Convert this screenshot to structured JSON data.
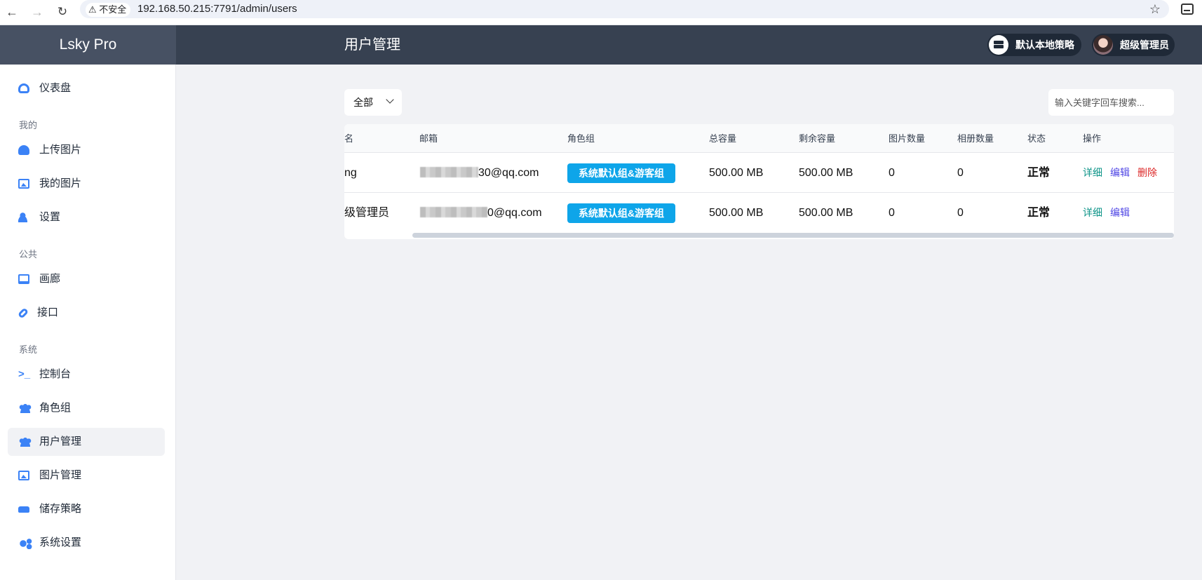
{
  "browser": {
    "security_label": "不安全",
    "url": "192.168.50.215:7791/admin/users"
  },
  "app": {
    "brand": "Lsky Pro",
    "page_title": "用户管理"
  },
  "header": {
    "strategy_label": "默认本地策略",
    "user_label": "超级管理员"
  },
  "sidebar": {
    "items": {
      "dashboard": "仪表盘",
      "section_mine": "我的",
      "upload": "上传图片",
      "my_images": "我的图片",
      "settings": "设置",
      "section_public": "公共",
      "gallery": "画廊",
      "api": "接口",
      "section_system": "系统",
      "console": "控制台",
      "groups": "角色组",
      "users": "用户管理",
      "images": "图片管理",
      "strategies": "储存策略",
      "system_settings": "系统设置"
    },
    "active": "users"
  },
  "filter": {
    "selected": "全部",
    "search_placeholder": "输入关键字回车搜索..."
  },
  "table": {
    "columns": {
      "name": "名",
      "email": "邮箱",
      "group": "角色组",
      "capacity": "总容量",
      "remaining": "剩余容量",
      "images": "图片数量",
      "albums": "相册数量",
      "status": "状态",
      "actions": "操作"
    },
    "rows": [
      {
        "name": "ng",
        "email_visible": "30@qq.com",
        "group": "系统默认组&游客组",
        "capacity": "500.00 MB",
        "remaining": "500.00 MB",
        "images": "0",
        "albums": "0",
        "status": "正常",
        "actions": {
          "detail": "详细",
          "edit": "编辑",
          "delete": "删除"
        }
      },
      {
        "name": "级管理员",
        "email_visible": "0@qq.com",
        "group": "系统默认组&游客组",
        "capacity": "500.00 MB",
        "remaining": "500.00 MB",
        "images": "0",
        "albums": "0",
        "status": "正常",
        "actions": {
          "detail": "详细",
          "edit": "编辑"
        }
      }
    ]
  }
}
